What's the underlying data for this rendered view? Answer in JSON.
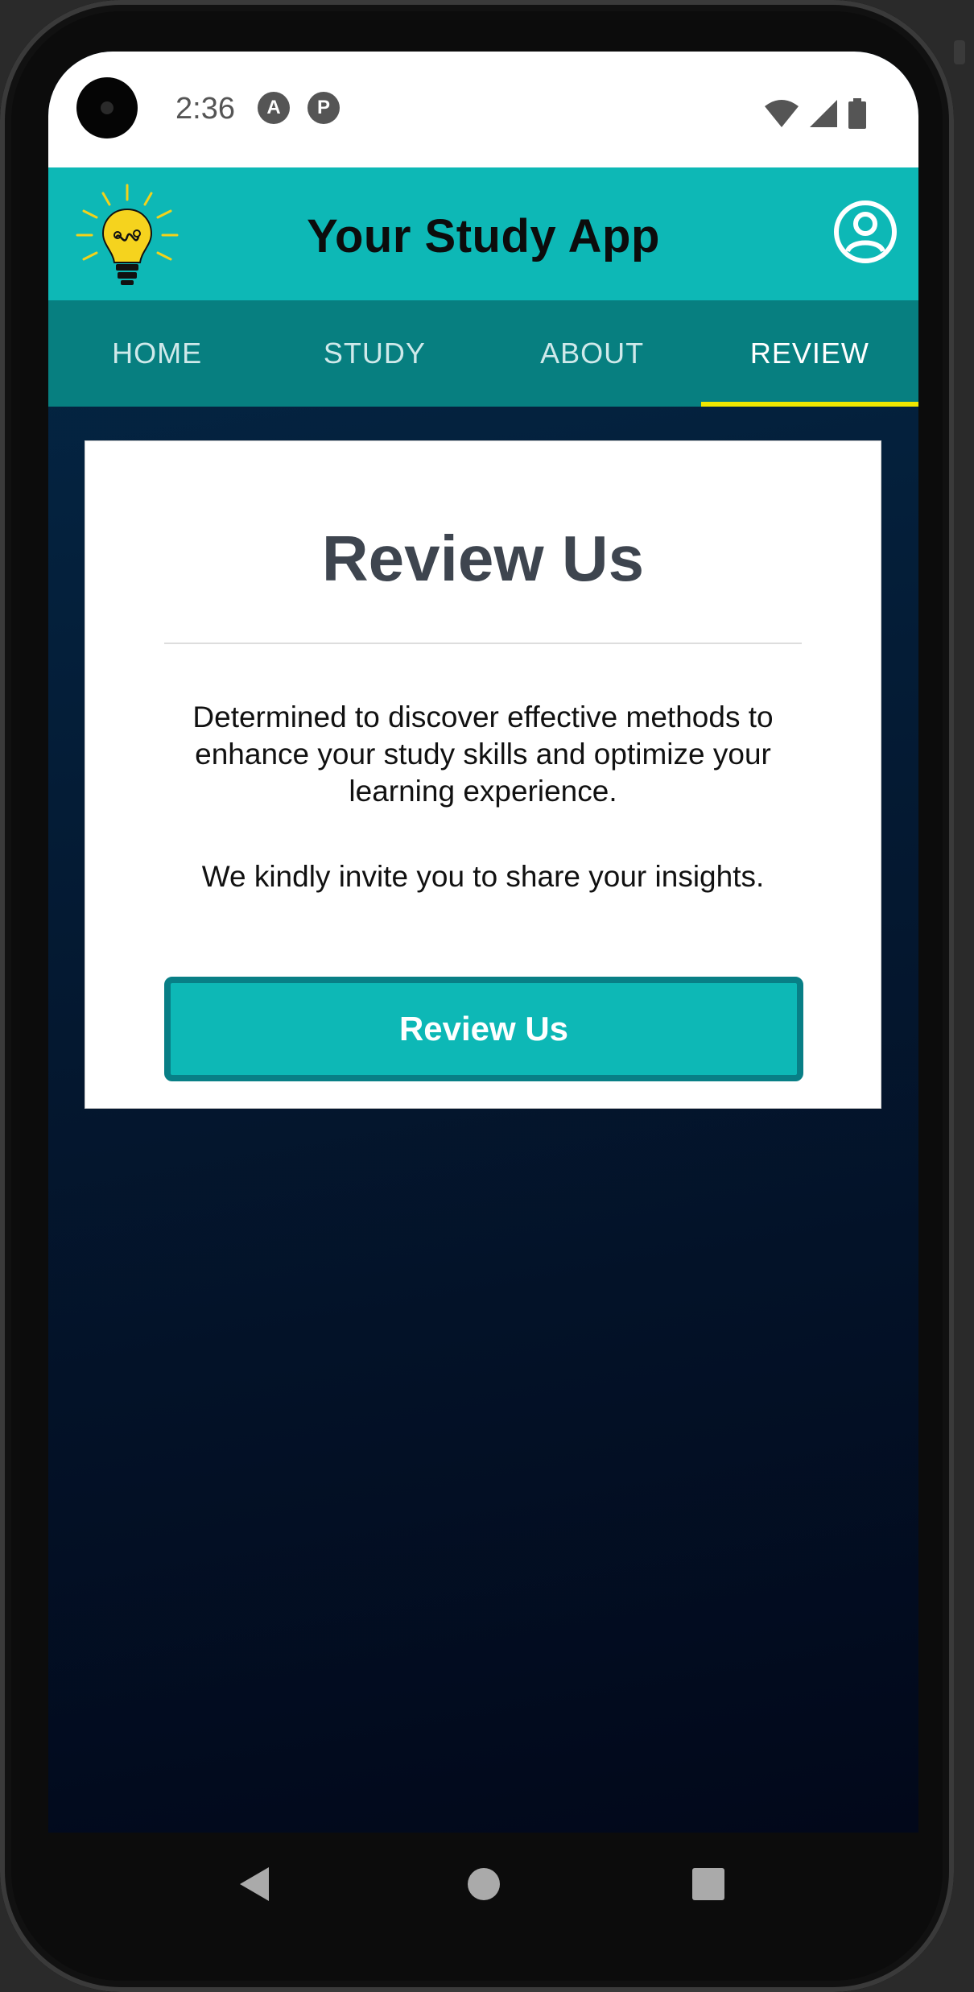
{
  "status_bar": {
    "time": "2:36",
    "notification_icons": [
      "A",
      "P"
    ]
  },
  "header": {
    "title": "Your Study App",
    "accent_color": "#0db8b6"
  },
  "tabs": [
    {
      "label": "HOME"
    },
    {
      "label": "STUDY"
    },
    {
      "label": "ABOUT"
    },
    {
      "label": "REVIEW",
      "active": true
    }
  ],
  "review_card": {
    "title": "Review Us",
    "description": "Determined to discover effective methods to enhance your study skills and optimize your learning experience.",
    "invite": "We kindly invite you to share your insights.",
    "button_label": "Review Us"
  },
  "colors": {
    "tab_bar": "#077f80",
    "active_tab_indicator": "#f0e800",
    "button_border": "#087f86"
  }
}
